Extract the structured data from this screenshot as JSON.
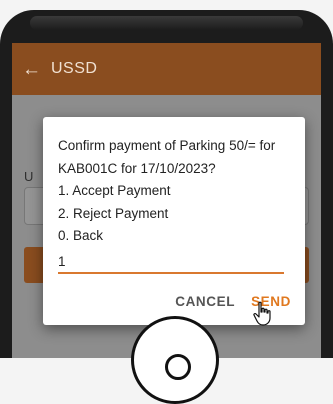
{
  "app": {
    "title": "USSD",
    "back_icon": "arrow-left-icon"
  },
  "background": {
    "field_label": "U"
  },
  "dialog": {
    "message_lines": [
      "Confirm payment of Parking 50/= for",
      "KAB001C for 17/10/2023?",
      "1. Accept Payment",
      "2. Reject Payment",
      "0. Back"
    ],
    "input_value": "1",
    "cancel_label": "CANCEL",
    "send_label": "SEND"
  },
  "colors": {
    "app_bar": "#8a4d1f",
    "accent": "#e0781f",
    "input_underline": "#d9782f"
  }
}
